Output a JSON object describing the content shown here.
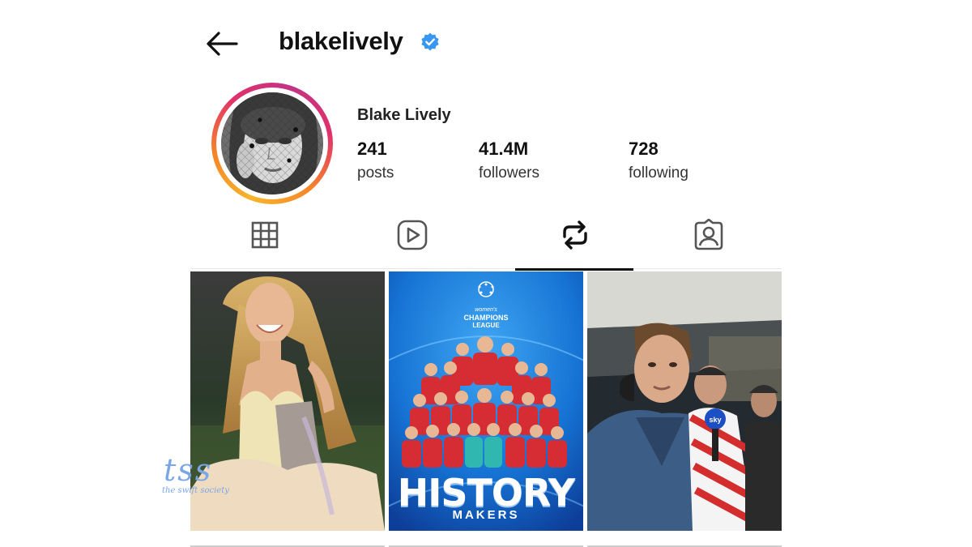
{
  "header": {
    "back_icon": "arrow-left-icon",
    "username": "blakelively",
    "verified_icon": "verified-badge-icon",
    "verified_color": "#3897f0"
  },
  "profile": {
    "display_name": "Blake Lively",
    "stats": [
      {
        "value": "241",
        "label": "posts"
      },
      {
        "value": "41.4M",
        "label": "followers"
      },
      {
        "value": "728",
        "label": "following"
      }
    ]
  },
  "tabs": [
    {
      "icon": "grid-icon",
      "active": false
    },
    {
      "icon": "reels-icon",
      "active": false
    },
    {
      "icon": "reposts-icon",
      "active": true
    },
    {
      "icon": "tagged-icon",
      "active": false
    }
  ],
  "posts": [
    {
      "kind": "photo",
      "subject": "gown-portrait"
    },
    {
      "kind": "graphic",
      "brand_top": "women's",
      "brand_mid": "CHAMPIONS",
      "brand_bottom": "LEAGUE",
      "headline": "HISTORY",
      "subheadline": "MAKERS"
    },
    {
      "kind": "photo",
      "subject": "stadium-interview",
      "mic_text": "sky"
    }
  ],
  "watermark": {
    "main": "tss",
    "sub": "the swift society",
    "color": "#7aa6e8"
  }
}
